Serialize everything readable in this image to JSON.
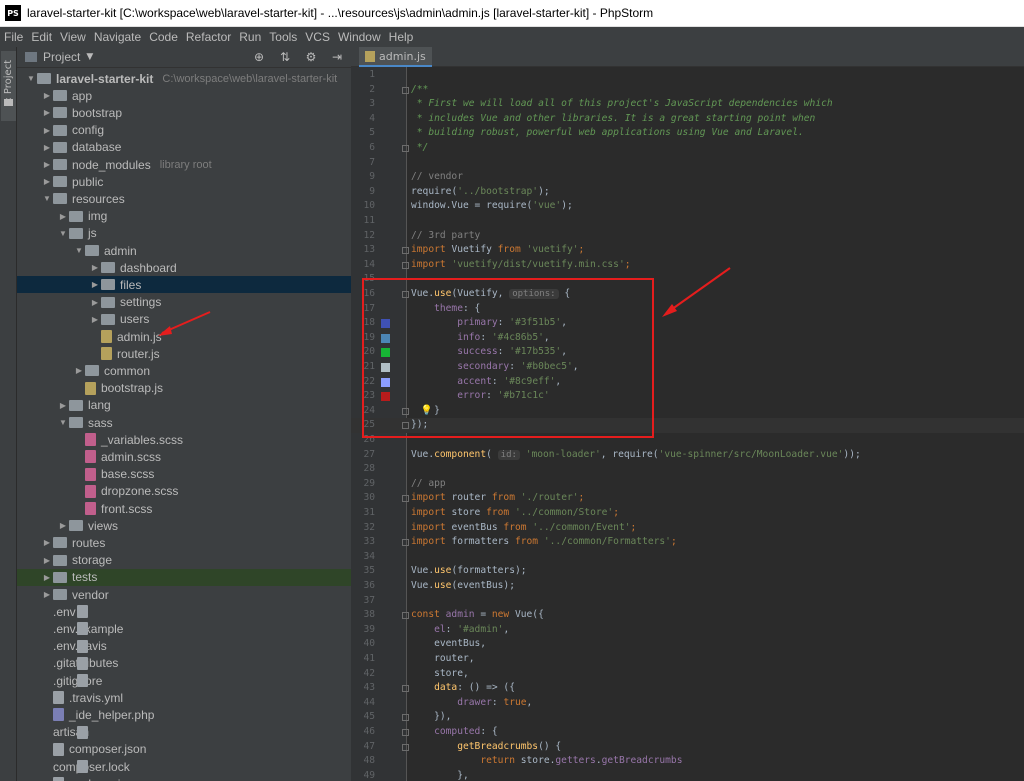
{
  "window": {
    "title": "laravel-starter-kit [C:\\workspace\\web\\laravel-starter-kit] - ...\\resources\\js\\admin\\admin.js [laravel-starter-kit] - PhpStorm",
    "app_icon": "PS"
  },
  "menu": [
    "File",
    "Edit",
    "View",
    "Navigate",
    "Code",
    "Refactor",
    "Run",
    "Tools",
    "VCS",
    "Window",
    "Help"
  ],
  "side_strip": {
    "tab_label": "1: Project"
  },
  "project_panel": {
    "title": "Project",
    "header_icons": [
      "target-icon",
      "collapse-icon",
      "gear-icon",
      "hide-icon"
    ],
    "tree": [
      {
        "label": "laravel-starter-kit",
        "hint": "C:\\workspace\\web\\laravel-starter-kit",
        "type": "folder",
        "depth": 0,
        "expanded": true
      },
      {
        "label": "app",
        "type": "folder",
        "depth": 1,
        "expanded": false
      },
      {
        "label": "bootstrap",
        "type": "folder",
        "depth": 1,
        "expanded": false
      },
      {
        "label": "config",
        "type": "folder",
        "depth": 1,
        "expanded": false
      },
      {
        "label": "database",
        "type": "folder",
        "depth": 1,
        "expanded": false
      },
      {
        "label": "node_modules",
        "hint": "library root",
        "type": "folder",
        "depth": 1,
        "expanded": false
      },
      {
        "label": "public",
        "type": "folder",
        "depth": 1,
        "expanded": false
      },
      {
        "label": "resources",
        "type": "folder",
        "depth": 1,
        "expanded": true
      },
      {
        "label": "img",
        "type": "folder",
        "depth": 2,
        "expanded": false
      },
      {
        "label": "js",
        "type": "folder",
        "depth": 2,
        "expanded": true
      },
      {
        "label": "admin",
        "type": "folder",
        "depth": 3,
        "expanded": true
      },
      {
        "label": "dashboard",
        "type": "folder",
        "depth": 4,
        "expanded": false
      },
      {
        "label": "files",
        "type": "folder",
        "depth": 4,
        "expanded": false,
        "selected": true
      },
      {
        "label": "settings",
        "type": "folder",
        "depth": 4,
        "expanded": false
      },
      {
        "label": "users",
        "type": "folder",
        "depth": 4,
        "expanded": false
      },
      {
        "label": "admin.js",
        "type": "js",
        "depth": 4
      },
      {
        "label": "router.js",
        "type": "js",
        "depth": 4
      },
      {
        "label": "common",
        "type": "folder",
        "depth": 3,
        "expanded": false
      },
      {
        "label": "bootstrap.js",
        "type": "js",
        "depth": 3
      },
      {
        "label": "lang",
        "type": "folder",
        "depth": 2,
        "expanded": false
      },
      {
        "label": "sass",
        "type": "folder",
        "depth": 2,
        "expanded": true
      },
      {
        "label": "_variables.scss",
        "type": "scss",
        "depth": 3
      },
      {
        "label": "admin.scss",
        "type": "scss",
        "depth": 3
      },
      {
        "label": "base.scss",
        "type": "scss",
        "depth": 3
      },
      {
        "label": "dropzone.scss",
        "type": "scss",
        "depth": 3
      },
      {
        "label": "front.scss",
        "type": "scss",
        "depth": 3
      },
      {
        "label": "views",
        "type": "folder",
        "depth": 2,
        "expanded": false
      },
      {
        "label": "routes",
        "type": "folder",
        "depth": 1,
        "expanded": false
      },
      {
        "label": "storage",
        "type": "folder",
        "depth": 1,
        "expanded": false
      },
      {
        "label": "tests",
        "type": "folder",
        "depth": 1,
        "expanded": false,
        "tests": true
      },
      {
        "label": "vendor",
        "type": "folder",
        "depth": 1,
        "expanded": false
      },
      {
        "label": ".env",
        "type": "txt",
        "depth": 1
      },
      {
        "label": ".env.example",
        "type": "txt",
        "depth": 1
      },
      {
        "label": ".env.travis",
        "type": "txt",
        "depth": 1
      },
      {
        "label": ".gitattributes",
        "type": "txt",
        "depth": 1
      },
      {
        "label": ".gitignore",
        "type": "txt",
        "depth": 1
      },
      {
        "label": ".travis.yml",
        "type": "yml",
        "depth": 1
      },
      {
        "label": "_ide_helper.php",
        "type": "php",
        "depth": 1
      },
      {
        "label": "artisan",
        "type": "txt",
        "depth": 1
      },
      {
        "label": "composer.json",
        "type": "json",
        "depth": 1
      },
      {
        "label": "composer.lock",
        "type": "txt",
        "depth": 1
      },
      {
        "label": "package.json",
        "type": "json",
        "depth": 1
      }
    ]
  },
  "editor": {
    "tab_label": "admin.js",
    "current_line": 25,
    "lines": [
      {
        "n": "1",
        "segs": []
      },
      {
        "n": "2",
        "fold": true,
        "segs": [
          {
            "t": "/**",
            "c": "c"
          }
        ]
      },
      {
        "n": "3",
        "segs": [
          {
            "t": " * First we will load all of this project's JavaScript dependencies which",
            "c": "c"
          }
        ]
      },
      {
        "n": "4",
        "segs": [
          {
            "t": " * includes Vue and other libraries. It is a great starting point when",
            "c": "c"
          }
        ]
      },
      {
        "n": "5",
        "segs": [
          {
            "t": " * building robust, powerful web applications using Vue and Laravel.",
            "c": "c"
          }
        ]
      },
      {
        "n": "6",
        "fold": true,
        "segs": [
          {
            "t": " */",
            "c": "c"
          }
        ]
      },
      {
        "n": "7",
        "segs": []
      },
      {
        "n": "9",
        "segs": [
          {
            "t": "// vendor",
            "c": "cm"
          }
        ]
      },
      {
        "n": "9",
        "segs": [
          {
            "t": "require",
            "c": ""
          },
          {
            "t": "(",
            "c": ""
          },
          {
            "t": "'../bootstrap'",
            "c": "s"
          },
          {
            "t": ");",
            "c": ""
          }
        ]
      },
      {
        "n": "10",
        "segs": [
          {
            "t": "window.Vue = ",
            "c": ""
          },
          {
            "t": "require",
            "c": ""
          },
          {
            "t": "(",
            "c": ""
          },
          {
            "t": "'vue'",
            "c": "s"
          },
          {
            "t": ");",
            "c": ""
          }
        ]
      },
      {
        "n": "11",
        "segs": []
      },
      {
        "n": "12",
        "segs": [
          {
            "t": "// 3rd party",
            "c": "cm"
          }
        ]
      },
      {
        "n": "13",
        "fold": true,
        "segs": [
          {
            "t": "import ",
            "c": "k"
          },
          {
            "t": "Vuetify ",
            "c": ""
          },
          {
            "t": "from ",
            "c": "k"
          },
          {
            "t": "'vuetify'",
            "c": "s"
          },
          {
            "t": ";",
            "c": "k"
          }
        ]
      },
      {
        "n": "14",
        "fold": true,
        "segs": [
          {
            "t": "import ",
            "c": "k"
          },
          {
            "t": "'vuetify/dist/vuetify.min.css'",
            "c": "s"
          },
          {
            "t": ";",
            "c": "k"
          }
        ]
      },
      {
        "n": "15",
        "segs": []
      },
      {
        "n": "16",
        "fold": true,
        "segs": [
          {
            "t": "Vue.",
            "c": ""
          },
          {
            "t": "use",
            "c": "fn"
          },
          {
            "t": "(Vuetify, ",
            "c": ""
          },
          {
            "t": "options:",
            "c": "hint"
          },
          {
            "t": " {",
            "c": ""
          }
        ]
      },
      {
        "n": "17",
        "segs": [
          {
            "t": "    ",
            "c": ""
          },
          {
            "t": "theme",
            "c": "p"
          },
          {
            "t": ": {",
            "c": ""
          }
        ]
      },
      {
        "n": "18",
        "swatch": "#3f51b5",
        "segs": [
          {
            "t": "        ",
            "c": ""
          },
          {
            "t": "primary",
            "c": "p"
          },
          {
            "t": ": ",
            "c": ""
          },
          {
            "t": "'#3f51b5'",
            "c": "s"
          },
          {
            "t": ",",
            "c": ""
          }
        ]
      },
      {
        "n": "19",
        "swatch": "#4c86b5",
        "segs": [
          {
            "t": "        ",
            "c": ""
          },
          {
            "t": "info",
            "c": "p"
          },
          {
            "t": ": ",
            "c": ""
          },
          {
            "t": "'#4c86b5'",
            "c": "s"
          },
          {
            "t": ",",
            "c": ""
          }
        ]
      },
      {
        "n": "20",
        "swatch": "#17b535",
        "segs": [
          {
            "t": "        ",
            "c": ""
          },
          {
            "t": "success",
            "c": "p"
          },
          {
            "t": ": ",
            "c": ""
          },
          {
            "t": "'#17b535'",
            "c": "s"
          },
          {
            "t": ",",
            "c": ""
          }
        ]
      },
      {
        "n": "21",
        "swatch": "#b0bec5",
        "segs": [
          {
            "t": "        ",
            "c": ""
          },
          {
            "t": "secondary",
            "c": "p"
          },
          {
            "t": ": ",
            "c": ""
          },
          {
            "t": "'#b0bec5'",
            "c": "s"
          },
          {
            "t": ",",
            "c": ""
          }
        ]
      },
      {
        "n": "22",
        "swatch": "#8c9eff",
        "segs": [
          {
            "t": "        ",
            "c": ""
          },
          {
            "t": "accent",
            "c": "p"
          },
          {
            "t": ": ",
            "c": ""
          },
          {
            "t": "'#8c9eff'",
            "c": "s"
          },
          {
            "t": ",",
            "c": ""
          }
        ]
      },
      {
        "n": "23",
        "swatch": "#b71c1c",
        "segs": [
          {
            "t": "        ",
            "c": ""
          },
          {
            "t": "error",
            "c": "p"
          },
          {
            "t": ": ",
            "c": ""
          },
          {
            "t": "'#b71c1c'",
            "c": "s"
          }
        ]
      },
      {
        "n": "24",
        "fold": true,
        "bulb": true,
        "segs": [
          {
            "t": "    }",
            "c": ""
          }
        ]
      },
      {
        "n": "25",
        "fold": true,
        "segs": [
          {
            "t": "});",
            "c": ""
          }
        ]
      },
      {
        "n": "26",
        "segs": []
      },
      {
        "n": "27",
        "segs": [
          {
            "t": "Vue.",
            "c": ""
          },
          {
            "t": "component",
            "c": "fn"
          },
          {
            "t": "( ",
            "c": ""
          },
          {
            "t": "id:",
            "c": "hint"
          },
          {
            "t": " ",
            "c": ""
          },
          {
            "t": "'moon-loader'",
            "c": "s"
          },
          {
            "t": ", ",
            "c": ""
          },
          {
            "t": "require",
            "c": ""
          },
          {
            "t": "(",
            "c": ""
          },
          {
            "t": "'vue-spinner/src/MoonLoader.vue'",
            "c": "s"
          },
          {
            "t": "));",
            "c": ""
          }
        ]
      },
      {
        "n": "28",
        "segs": []
      },
      {
        "n": "29",
        "segs": [
          {
            "t": "// app",
            "c": "cm"
          }
        ]
      },
      {
        "n": "30",
        "fold": true,
        "segs": [
          {
            "t": "import ",
            "c": "k"
          },
          {
            "t": "router ",
            "c": ""
          },
          {
            "t": "from ",
            "c": "k"
          },
          {
            "t": "'./router'",
            "c": "s"
          },
          {
            "t": ";",
            "c": "k"
          }
        ]
      },
      {
        "n": "31",
        "segs": [
          {
            "t": "import ",
            "c": "k"
          },
          {
            "t": "store ",
            "c": ""
          },
          {
            "t": "from ",
            "c": "k"
          },
          {
            "t": "'../common/Store'",
            "c": "s"
          },
          {
            "t": ";",
            "c": "k"
          }
        ]
      },
      {
        "n": "32",
        "segs": [
          {
            "t": "import ",
            "c": "k"
          },
          {
            "t": "eventBus ",
            "c": ""
          },
          {
            "t": "from ",
            "c": "k"
          },
          {
            "t": "'../common/Event'",
            "c": "s"
          },
          {
            "t": ";",
            "c": "k"
          }
        ]
      },
      {
        "n": "33",
        "fold": true,
        "segs": [
          {
            "t": "import ",
            "c": "k"
          },
          {
            "t": "formatters ",
            "c": ""
          },
          {
            "t": "from ",
            "c": "k"
          },
          {
            "t": "'../common/Formatters'",
            "c": "s"
          },
          {
            "t": ";",
            "c": "k"
          }
        ]
      },
      {
        "n": "34",
        "segs": []
      },
      {
        "n": "35",
        "segs": [
          {
            "t": "Vue.",
            "c": ""
          },
          {
            "t": "use",
            "c": "fn"
          },
          {
            "t": "(formatters);",
            "c": ""
          }
        ]
      },
      {
        "n": "36",
        "segs": [
          {
            "t": "Vue.",
            "c": ""
          },
          {
            "t": "use",
            "c": "fn"
          },
          {
            "t": "(eventBus);",
            "c": ""
          }
        ]
      },
      {
        "n": "37",
        "segs": []
      },
      {
        "n": "38",
        "fold": true,
        "segs": [
          {
            "t": "const ",
            "c": "k"
          },
          {
            "t": "admin",
            "c": "p"
          },
          {
            "t": " = ",
            "c": ""
          },
          {
            "t": "new ",
            "c": "k"
          },
          {
            "t": "Vue({",
            "c": ""
          }
        ]
      },
      {
        "n": "39",
        "segs": [
          {
            "t": "    ",
            "c": ""
          },
          {
            "t": "el",
            "c": "p"
          },
          {
            "t": ": ",
            "c": ""
          },
          {
            "t": "'#admin'",
            "c": "s"
          },
          {
            "t": ",",
            "c": ""
          }
        ]
      },
      {
        "n": "40",
        "segs": [
          {
            "t": "    eventBus,",
            "c": ""
          }
        ]
      },
      {
        "n": "41",
        "segs": [
          {
            "t": "    router,",
            "c": ""
          }
        ]
      },
      {
        "n": "42",
        "segs": [
          {
            "t": "    store,",
            "c": ""
          }
        ]
      },
      {
        "n": "43",
        "fold": true,
        "segs": [
          {
            "t": "    ",
            "c": ""
          },
          {
            "t": "data",
            "c": "fn"
          },
          {
            "t": ": () => ({",
            "c": ""
          }
        ]
      },
      {
        "n": "44",
        "segs": [
          {
            "t": "        ",
            "c": ""
          },
          {
            "t": "drawer",
            "c": "p"
          },
          {
            "t": ": ",
            "c": ""
          },
          {
            "t": "true",
            "c": "k"
          },
          {
            "t": ",",
            "c": ""
          }
        ]
      },
      {
        "n": "45",
        "fold": true,
        "segs": [
          {
            "t": "    }),",
            "c": ""
          }
        ]
      },
      {
        "n": "46",
        "fold": true,
        "segs": [
          {
            "t": "    ",
            "c": ""
          },
          {
            "t": "computed",
            "c": "p"
          },
          {
            "t": ": {",
            "c": ""
          }
        ]
      },
      {
        "n": "47",
        "fold": true,
        "segs": [
          {
            "t": "        ",
            "c": ""
          },
          {
            "t": "getBreadcrumbs",
            "c": "fn"
          },
          {
            "t": "() {",
            "c": ""
          }
        ]
      },
      {
        "n": "48",
        "segs": [
          {
            "t": "            ",
            "c": ""
          },
          {
            "t": "return ",
            "c": "k"
          },
          {
            "t": "store.",
            "c": ""
          },
          {
            "t": "getters",
            "c": "p"
          },
          {
            "t": ".",
            "c": ""
          },
          {
            "t": "getBreadcrumbs",
            "c": "p"
          }
        ]
      },
      {
        "n": "49",
        "segs": [
          {
            "t": "        },",
            "c": ""
          }
        ]
      }
    ]
  }
}
